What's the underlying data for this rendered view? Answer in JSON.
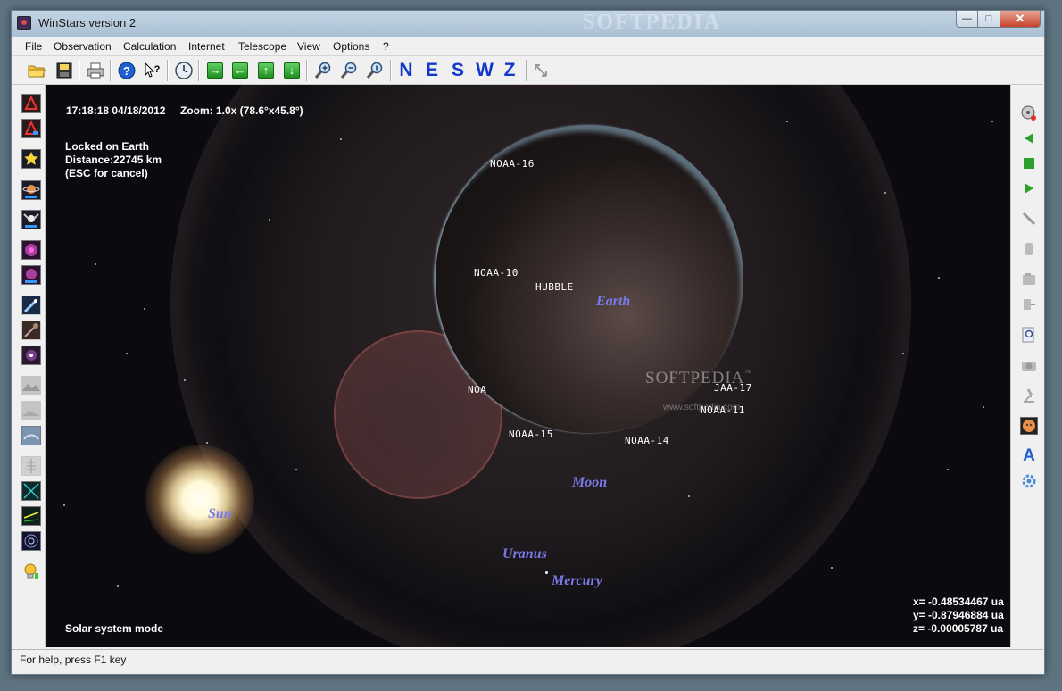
{
  "window": {
    "title": "WinStars version 2",
    "watermark": "SOFTPEDIA"
  },
  "menu": [
    "File",
    "Observation",
    "Calculation",
    "Internet",
    "Telescope",
    "View",
    "Options",
    "?"
  ],
  "toolbar": {
    "directions": [
      "N",
      "E",
      "S",
      "W",
      "Z"
    ],
    "icons": [
      "open-folder-icon",
      "save-icon",
      "print-icon",
      "help-icon",
      "context-help-icon",
      "clock-icon",
      "arrow-right-icon",
      "arrow-left-icon",
      "arrow-up-icon",
      "arrow-down-icon",
      "zoom-in-icon",
      "zoom-out-icon",
      "zoom-reset-icon",
      "resize-icon"
    ]
  },
  "view": {
    "datetime": "17:18:18  04/18/2012",
    "zoom": "Zoom: 1.0x (78.6°x45.8°)",
    "lock_line1": "Locked on Earth",
    "lock_line2": "Distance:22745 km",
    "lock_line3": "(ESC for cancel)",
    "mode": "Solar system mode",
    "coord_x": "x= -0.48534467 ua",
    "coord_y": "y= -0.87946884 ua",
    "coord_z": "z= -0.00005787 ua",
    "satellites": [
      "NOAA-16",
      "NOAA-10",
      "HUBBLE",
      "NOA",
      "NOAA-15",
      "NOAA-14",
      "JAA-17",
      "NOAA-11"
    ],
    "bodies": [
      "Earth",
      "Moon",
      "Sun",
      "Uranus",
      "Mercury"
    ],
    "watermark": "SOFTPEDIA",
    "watermark_url": "www.softpedia.com",
    "watermark_tm": "™"
  },
  "status": {
    "text": "For help, press F1 key"
  },
  "colors": {
    "direction_letters": "#1238c8",
    "body_labels": "#7a7ae8"
  }
}
